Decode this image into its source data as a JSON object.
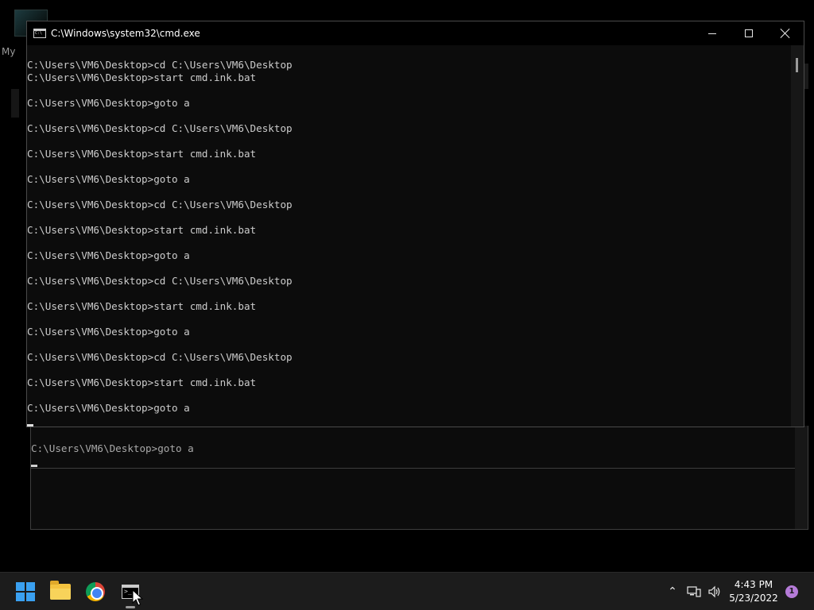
{
  "desktop": {
    "icon_label": "My"
  },
  "window": {
    "title": "C:\\Windows\\system32\\cmd.exe",
    "console_lines": [
      "C:\\Users\\VM6\\Desktop>cd C:\\Users\\VM6\\Desktop",
      "C:\\Users\\VM6\\Desktop>start cmd.ink.bat",
      "",
      "C:\\Users\\VM6\\Desktop>goto a",
      "",
      "C:\\Users\\VM6\\Desktop>cd C:\\Users\\VM6\\Desktop",
      "",
      "C:\\Users\\VM6\\Desktop>start cmd.ink.bat",
      "",
      "C:\\Users\\VM6\\Desktop>goto a",
      "",
      "C:\\Users\\VM6\\Desktop>cd C:\\Users\\VM6\\Desktop",
      "",
      "C:\\Users\\VM6\\Desktop>start cmd.ink.bat",
      "",
      "C:\\Users\\VM6\\Desktop>goto a",
      "",
      "C:\\Users\\VM6\\Desktop>cd C:\\Users\\VM6\\Desktop",
      "",
      "C:\\Users\\VM6\\Desktop>start cmd.ink.bat",
      "",
      "C:\\Users\\VM6\\Desktop>goto a",
      "",
      "C:\\Users\\VM6\\Desktop>cd C:\\Users\\VM6\\Desktop",
      "",
      "C:\\Users\\VM6\\Desktop>start cmd.ink.bat",
      "",
      "C:\\Users\\VM6\\Desktop>goto a"
    ]
  },
  "background_window": {
    "line": "C:\\Users\\VM6\\Desktop>goto a"
  },
  "taskbar": {
    "apps": [
      "start-icon",
      "file-explorer-icon",
      "chrome-icon",
      "cmd-icon"
    ],
    "clock_time": "4:43 PM",
    "clock_date": "5/23/2022",
    "notification_count": "1"
  }
}
